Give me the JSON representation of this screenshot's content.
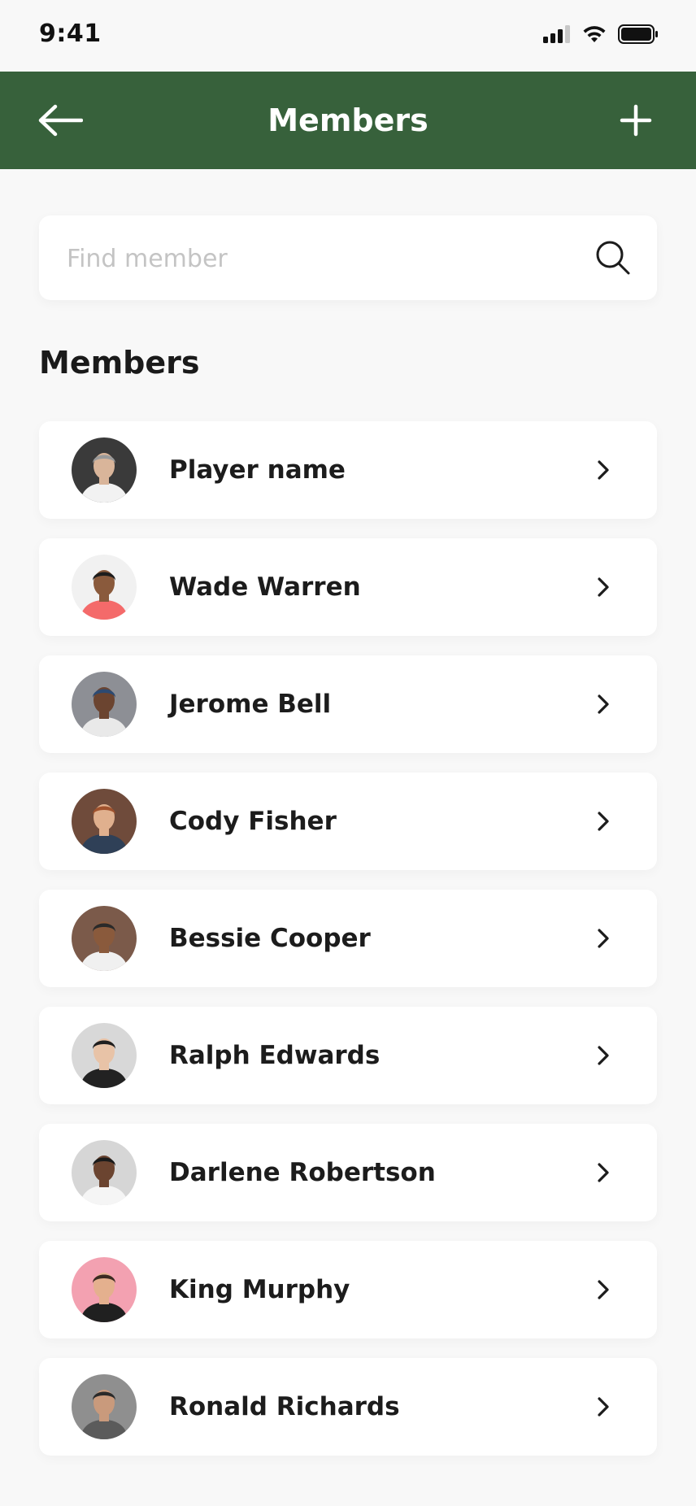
{
  "status_bar": {
    "time": "9:41"
  },
  "header": {
    "title": "Members"
  },
  "search": {
    "placeholder": "Find member",
    "value": ""
  },
  "section": {
    "title": "Members"
  },
  "members": [
    {
      "name": "Player name",
      "avatar_bg": "#3a3a3a",
      "skin": "#d9b59a",
      "shirt": "#f2f2f2",
      "hair": "#9a9a9a"
    },
    {
      "name": "Wade Warren",
      "avatar_bg": "#f1f1f1",
      "skin": "#8a5a3c",
      "shirt": "#f46a6a",
      "hair": "#1d1d1d"
    },
    {
      "name": "Jerome Bell",
      "avatar_bg": "#8d8f95",
      "skin": "#6b4430",
      "shirt": "#e9e9e9",
      "hair": "#2c4a72"
    },
    {
      "name": "Cody Fisher",
      "avatar_bg": "#6f4b3b",
      "skin": "#e0b08e",
      "shirt": "#2f4057",
      "hair": "#a0522d"
    },
    {
      "name": "Bessie Cooper",
      "avatar_bg": "#7b5a4a",
      "skin": "#8a5a3c",
      "shirt": "#f0f0f0",
      "hair": "#2a2a2a"
    },
    {
      "name": "Ralph Edwards",
      "avatar_bg": "#d8d8d8",
      "skin": "#e8c3a7",
      "shirt": "#222222",
      "hair": "#1f1f1f"
    },
    {
      "name": "Darlene Robertson",
      "avatar_bg": "#d6d6d6",
      "skin": "#6b4430",
      "shirt": "#f5f5f5",
      "hair": "#1b1b1b"
    },
    {
      "name": "King Murphy",
      "avatar_bg": "#f3a1b1",
      "skin": "#e4b08e",
      "shirt": "#202020",
      "hair": "#3b2a22"
    },
    {
      "name": "Ronald Richards",
      "avatar_bg": "#8f8f8f",
      "skin": "#c99a7c",
      "shirt": "#5b5b5b",
      "hair": "#2a2a2a"
    }
  ],
  "colors": {
    "header": "#37613b",
    "background": "#f8f8f8",
    "card": "#ffffff"
  },
  "icons": {
    "back": "arrow-left-icon",
    "add": "plus-icon",
    "search": "search-icon",
    "chevron": "chevron-right-icon"
  }
}
